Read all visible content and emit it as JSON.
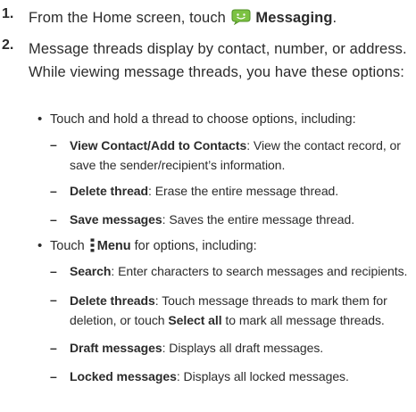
{
  "step1": {
    "number": "1.",
    "pre": "From the Home screen, touch",
    "label": "Messaging",
    "post": "."
  },
  "step2": {
    "number": "2.",
    "text": "Message threads display by contact, number, or address. While viewing message threads, you have these options:"
  },
  "bullet1": {
    "symbol": "•",
    "text": "Touch and hold a thread to choose options, including:",
    "items": [
      {
        "title": "View Contact/Add to Contacts",
        "desc": ": View the contact record, or save the sender/recipient’s information."
      },
      {
        "title": "Delete thread",
        "desc": ": Erase the entire message thread."
      },
      {
        "title": "Save messages",
        "desc": ": Saves the entire message thread."
      }
    ]
  },
  "bullet2": {
    "symbol": "•",
    "pre": "Touch",
    "label": "Menu",
    "post": " for options, including:",
    "items": [
      {
        "title": "Search",
        "desc": ": Enter characters to search messages and recipients."
      },
      {
        "title": "Delete threads",
        "desc_pre": ": Touch message threads to mark them for deletion, or touch ",
        "bold": "Select all",
        "desc_post": " to mark all message threads."
      },
      {
        "title": "Draft messages",
        "desc": ": Displays all draft messages."
      },
      {
        "title": "Locked messages",
        "desc": ": Displays all locked messages."
      }
    ]
  },
  "dash": "–",
  "colors": {
    "icon_green": "#7cc242",
    "icon_green_dark": "#4f8f25",
    "text": "#2b2b2b"
  },
  "icons": {
    "messaging": "messaging-icon",
    "menu": "menu-icon"
  }
}
